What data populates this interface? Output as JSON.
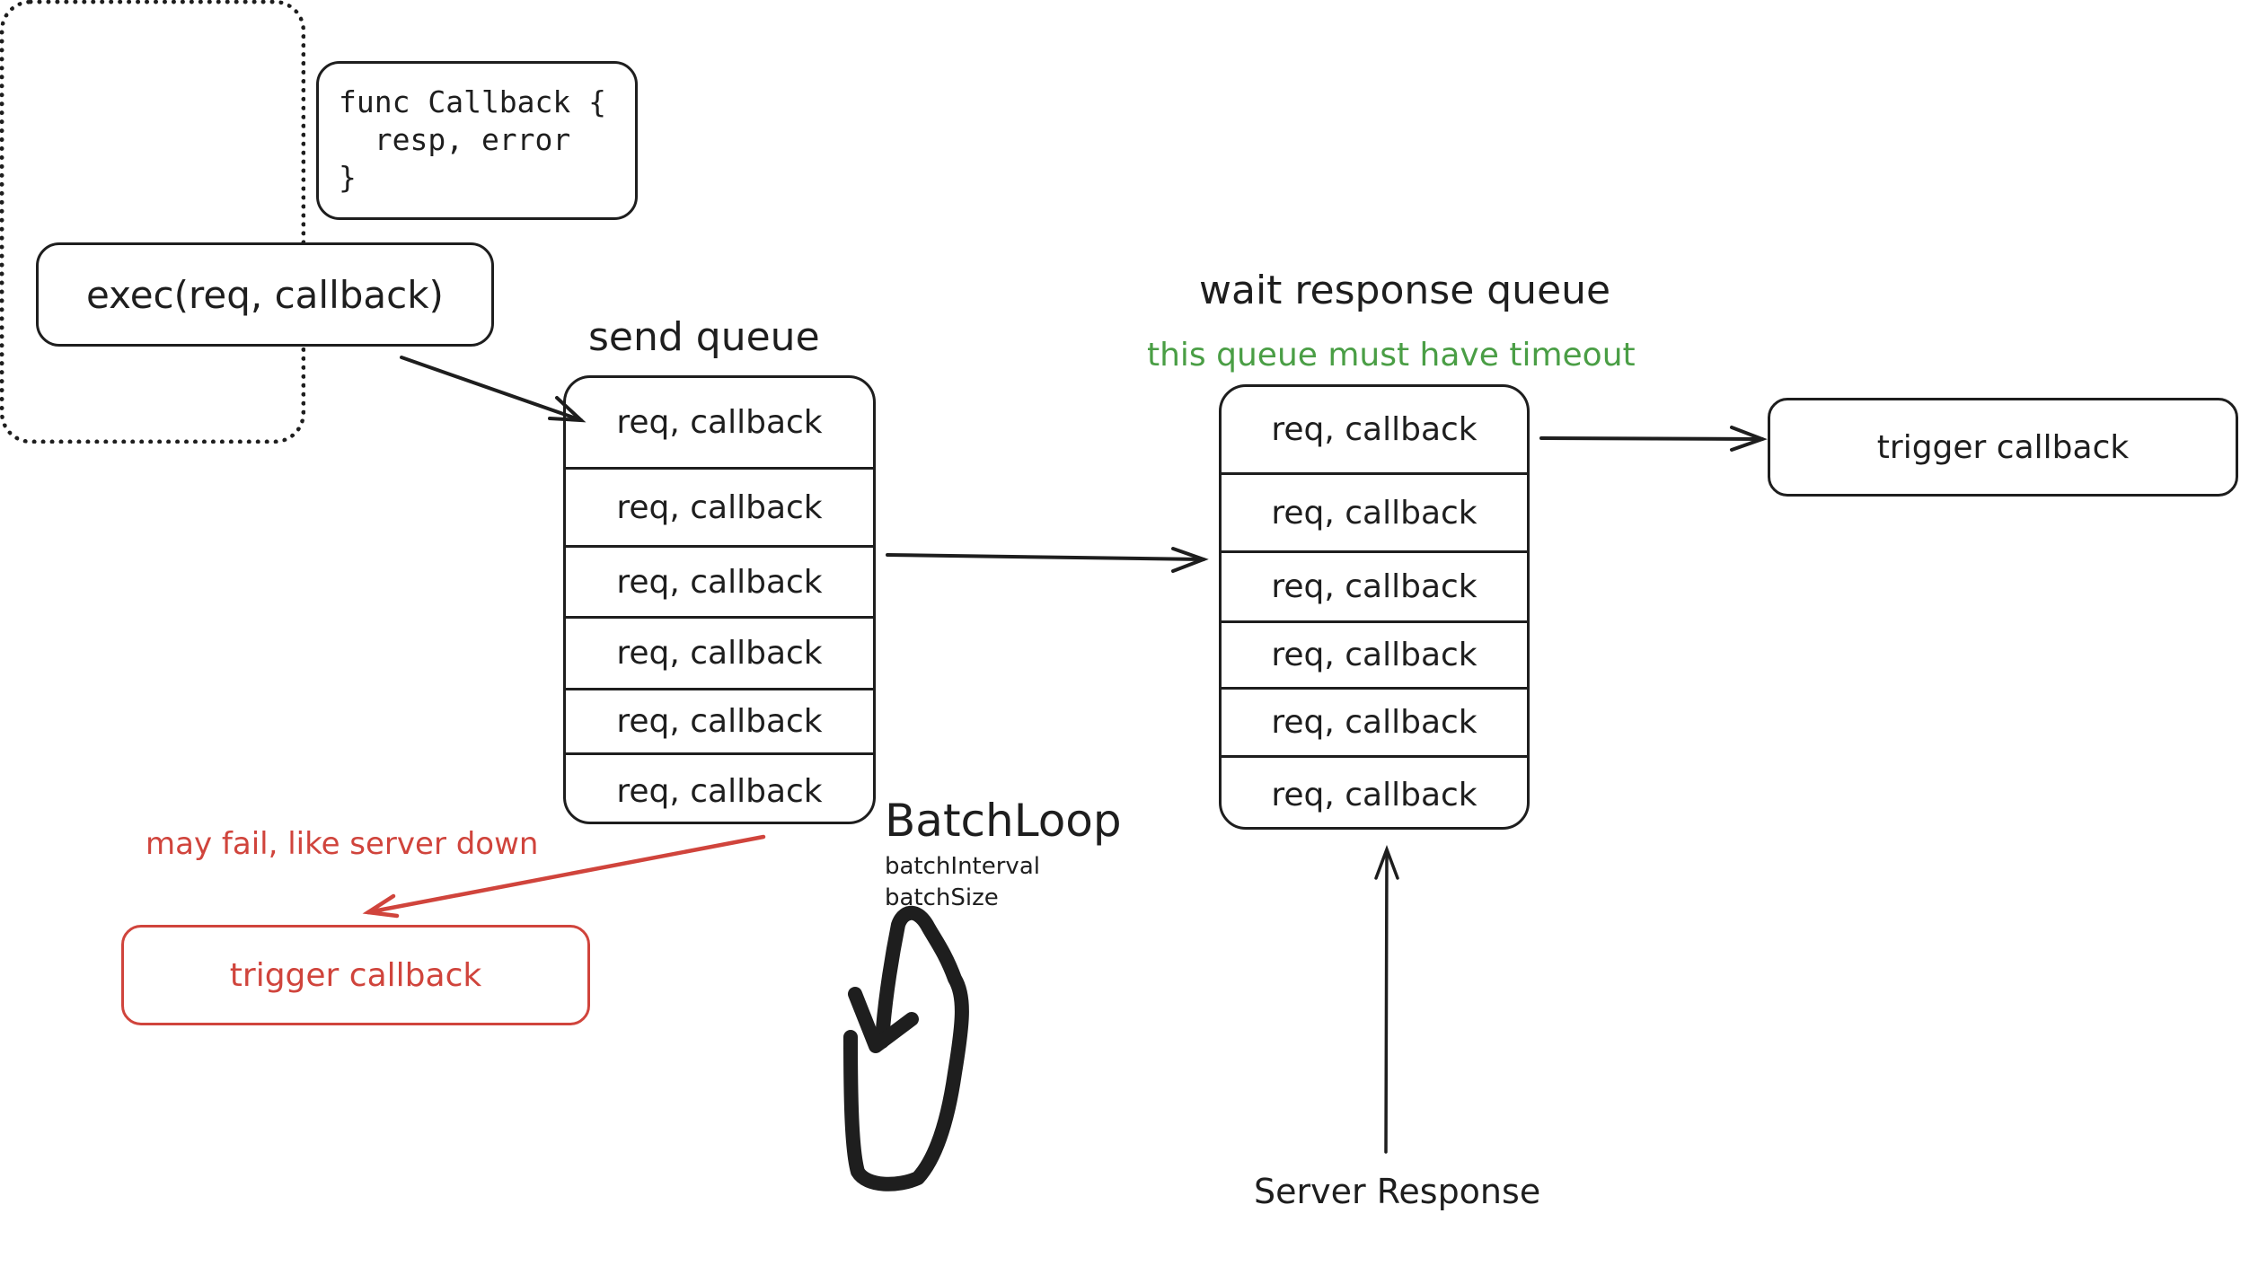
{
  "callback_definition": {
    "lines": [
      "func Callback {",
      "  resp, error",
      "}"
    ]
  },
  "exec_call": {
    "label": "exec(req, callback)"
  },
  "send_queue": {
    "title": "send queue",
    "rows": [
      "req, callback",
      "req, callback",
      "req, callback",
      "req, callback",
      "req, callback",
      "req, callback"
    ]
  },
  "wait_queue": {
    "title": "wait response queue",
    "note": "this queue must have timeout",
    "rows": [
      "req, callback",
      "req, callback",
      "req, callback",
      "req, callback",
      "req, callback",
      "req, callback"
    ]
  },
  "trigger_success": {
    "label": "trigger callback"
  },
  "failure": {
    "note": "may fail, like server down",
    "trigger_label": "trigger callback"
  },
  "batch_loop": {
    "title": "BatchLoop",
    "params": [
      "batchInterval",
      "batchSize"
    ],
    "icon": "loop-arrow-icon"
  },
  "server_response": {
    "label": "Server Response"
  },
  "colors": {
    "stroke": "#1e1e1e",
    "error": "#d0443c",
    "note_green": "#4a9e45",
    "background": "#ffffff"
  }
}
